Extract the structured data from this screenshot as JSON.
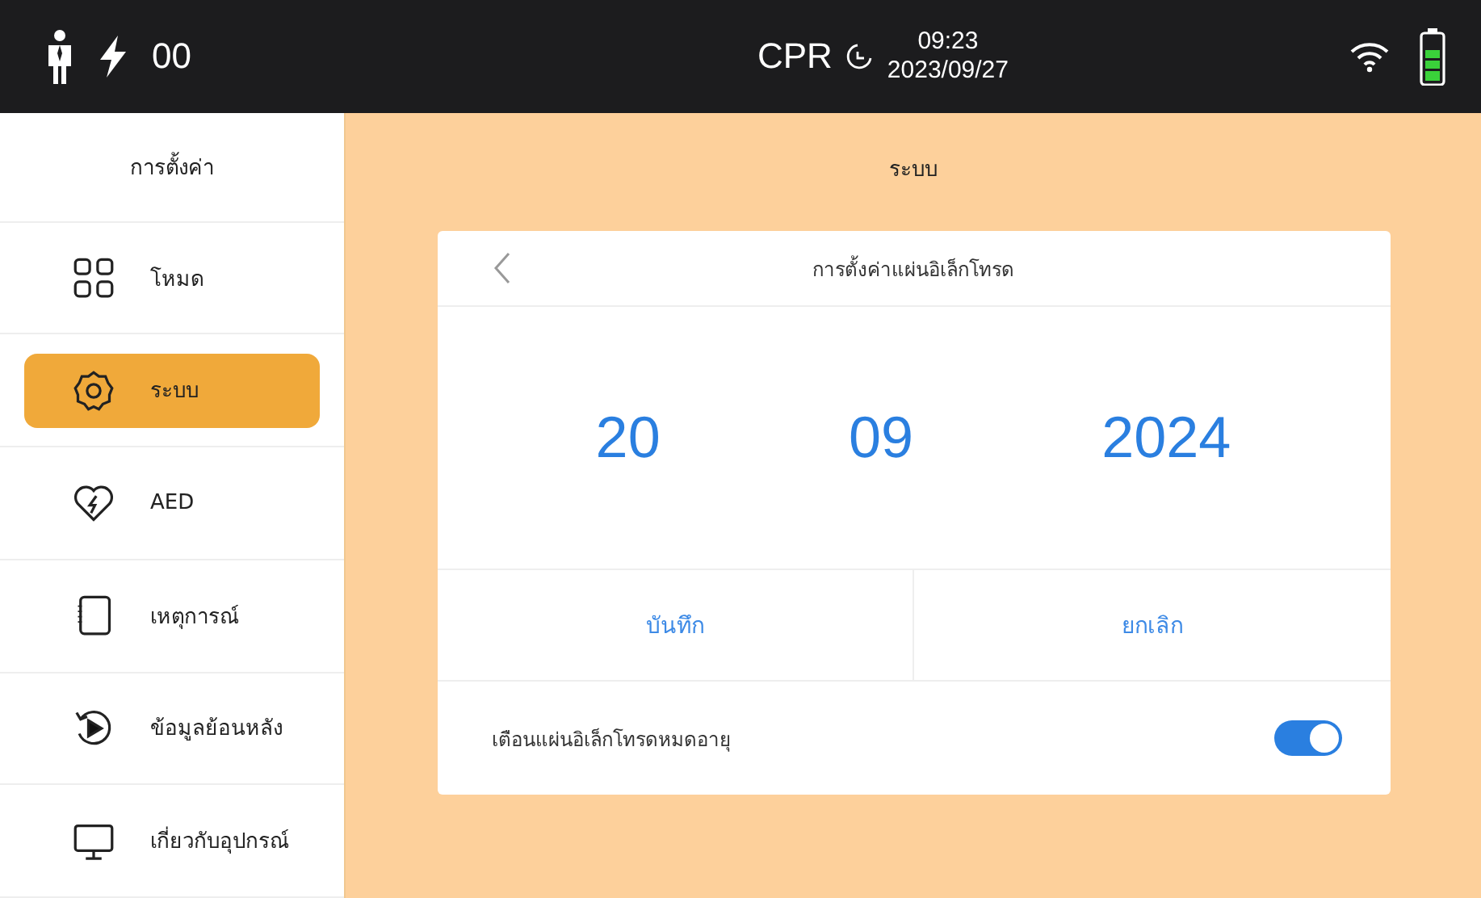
{
  "status_bar": {
    "shock_count": "00",
    "mode": "CPR",
    "time": "09:23",
    "date": "2023/09/27"
  },
  "sidebar": {
    "title": "การตั้งค่า",
    "items": [
      {
        "kind": "grid",
        "label": "โหมด",
        "selected": false
      },
      {
        "kind": "gear",
        "label": "ระบบ",
        "selected": true
      },
      {
        "kind": "heart",
        "label": "AED",
        "selected": false
      },
      {
        "kind": "notebook",
        "label": "เหตุการณ์",
        "selected": false
      },
      {
        "kind": "replay",
        "label": "ข้อมูลย้อนหลัง",
        "selected": false
      },
      {
        "kind": "monitor",
        "label": "เกี่ยวกับอุปกรณ์",
        "selected": false
      }
    ]
  },
  "page_title": "ระบบ",
  "dialog": {
    "title": "การตั้งค่าแผ่นอิเล็กโทรด",
    "date": [
      "20",
      "09",
      "2024"
    ],
    "buttons": [
      "บันทึก",
      "ยกเลิก"
    ],
    "setting": {
      "label": "เตือนแผ่นอิเล็กโทรดหมดอายุ",
      "on": true
    }
  }
}
